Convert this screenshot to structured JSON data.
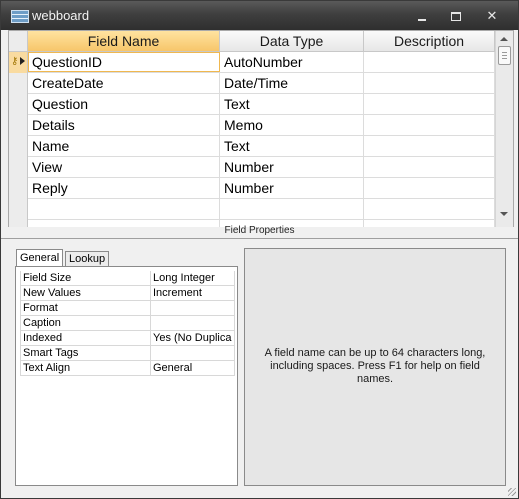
{
  "window": {
    "title": "webboard",
    "icon": "table-icon"
  },
  "grid": {
    "columns": [
      "Field Name",
      "Data Type",
      "Description"
    ],
    "rows": [
      {
        "name": "QuestionID",
        "type": "AutoNumber",
        "description": "",
        "primary_key": true,
        "selected": true
      },
      {
        "name": "CreateDate",
        "type": "Date/Time",
        "description": ""
      },
      {
        "name": "Question",
        "type": "Text",
        "description": ""
      },
      {
        "name": "Details",
        "type": "Memo",
        "description": ""
      },
      {
        "name": "Name",
        "type": "Text",
        "description": ""
      },
      {
        "name": "View",
        "type": "Number",
        "description": ""
      },
      {
        "name": "Reply",
        "type": "Number",
        "description": ""
      },
      {
        "name": "",
        "type": "",
        "description": ""
      },
      {
        "name": "",
        "type": "",
        "description": ""
      }
    ]
  },
  "field_properties": {
    "label": "Field Properties",
    "tabs": [
      "General",
      "Lookup"
    ],
    "active_tab": "General",
    "properties": [
      {
        "name": "Field Size",
        "value": "Long Integer"
      },
      {
        "name": "New Values",
        "value": "Increment"
      },
      {
        "name": "Format",
        "value": ""
      },
      {
        "name": "Caption",
        "value": ""
      },
      {
        "name": "Indexed",
        "value": "Yes (No Duplica"
      },
      {
        "name": "Smart Tags",
        "value": ""
      },
      {
        "name": "Text Align",
        "value": "General"
      }
    ],
    "help_text": "A field name can be up to 64 characters long, including spaces.  Press F1 for help on field names."
  }
}
